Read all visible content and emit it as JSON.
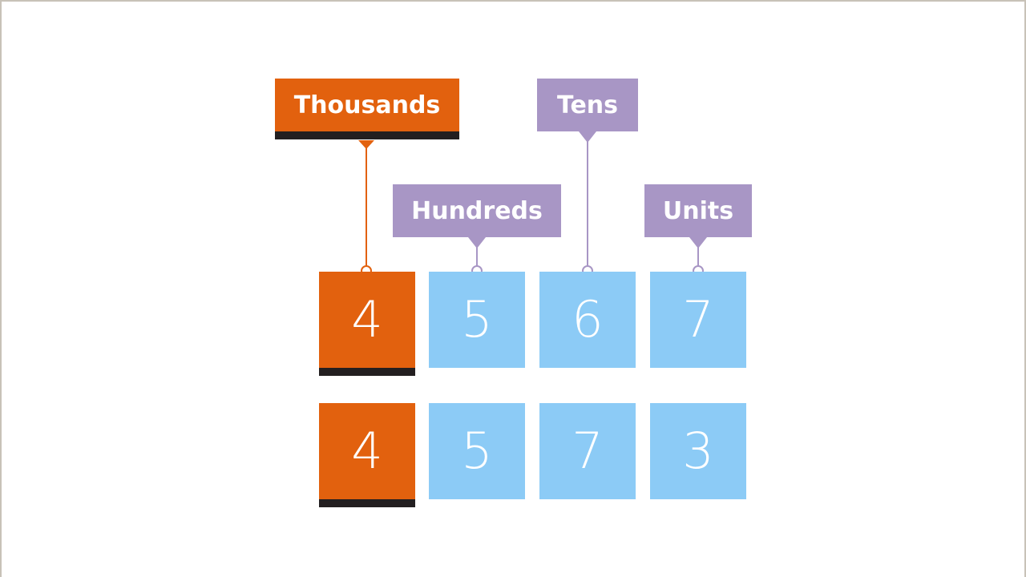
{
  "colors": {
    "thousands": "#e2610e",
    "place_label": "#a896c5",
    "digit_tile": "#8ccbf6",
    "shadow": "#231f20",
    "text": "#ffffff"
  },
  "labels": {
    "thousands": "Thousands",
    "hundreds": "Hundreds",
    "tens": "Tens",
    "units": "Units"
  },
  "rows": [
    {
      "digits": [
        "4",
        "5",
        "6",
        "7"
      ]
    },
    {
      "digits": [
        "4",
        "5",
        "7",
        "3"
      ]
    }
  ]
}
